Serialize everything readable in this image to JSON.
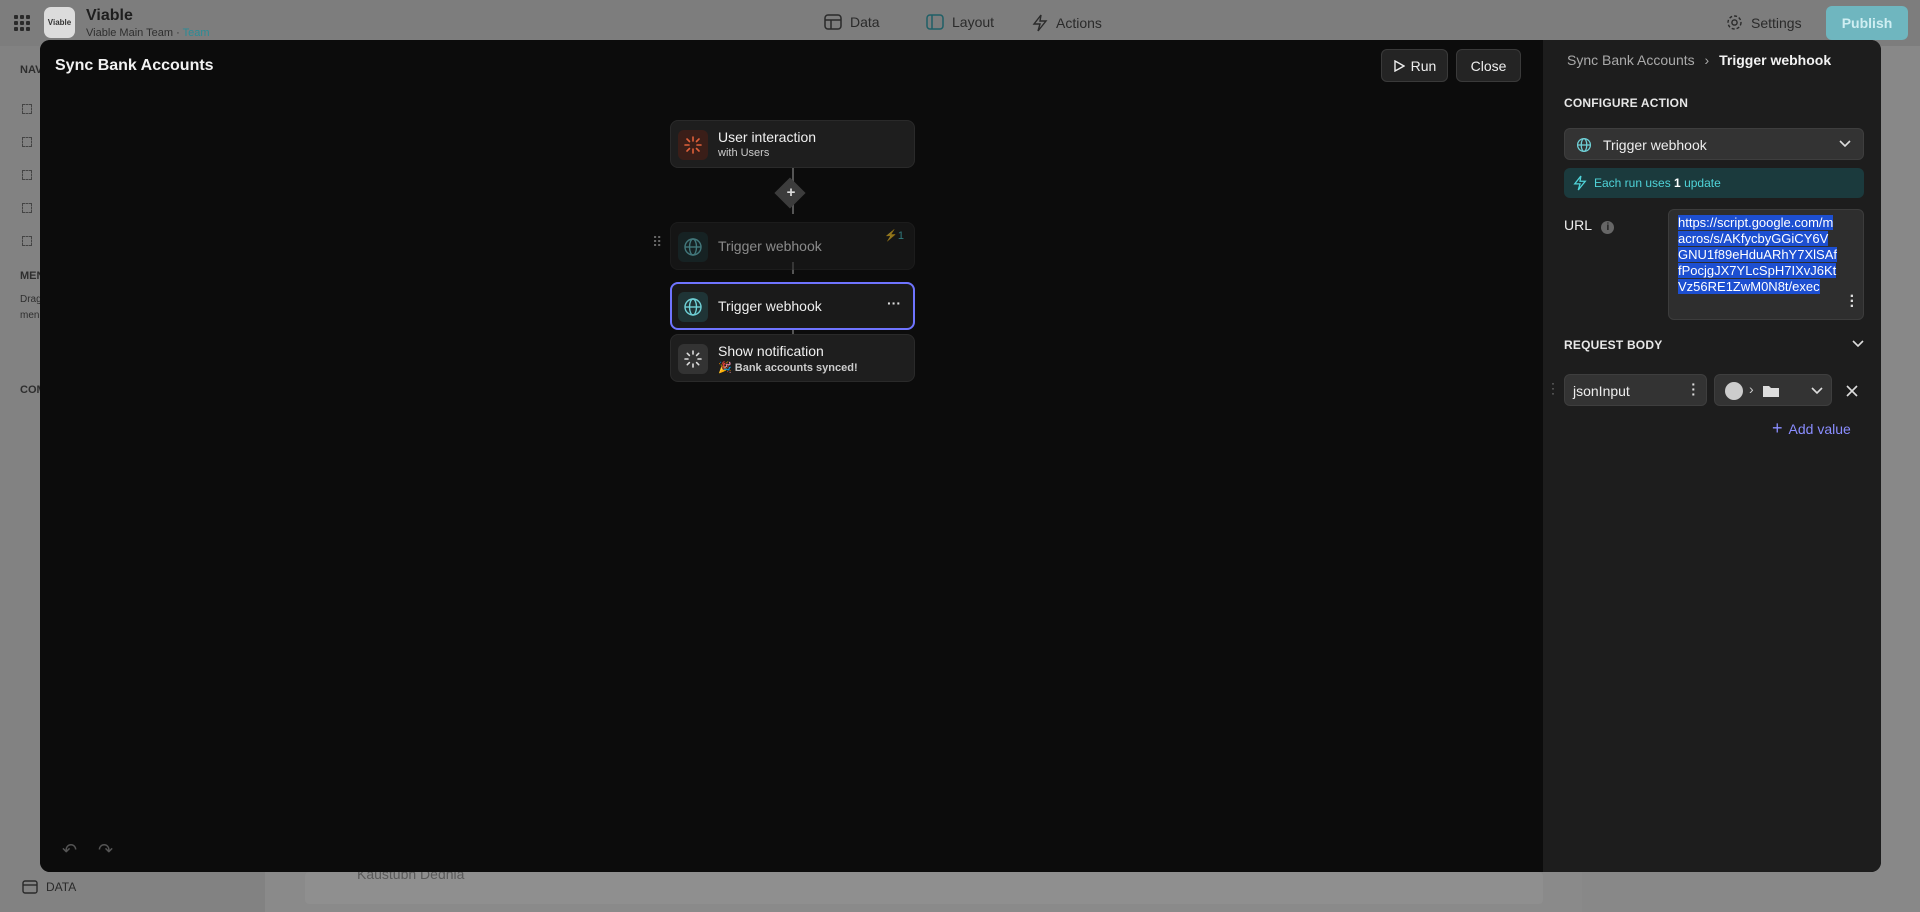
{
  "app": {
    "logo": "Viable",
    "title": "Viable",
    "team": "Viable Main Team",
    "team_link": "Team"
  },
  "topnav": {
    "data": "Data",
    "layout": "Layout",
    "actions": "Actions",
    "settings": "Settings",
    "publish": "Publish"
  },
  "left": {
    "nav": "NAV",
    "menu": "MEN",
    "menu_desc1": "Drag",
    "menu_desc2": "men",
    "comp": "COM",
    "data_tab": "DATA"
  },
  "bottom": {
    "name": "Kaustubh Dedhia"
  },
  "modal": {
    "title": "Sync Bank Accounts",
    "run": "Run",
    "close": "Close"
  },
  "flow": {
    "n1": {
      "title": "User interaction",
      "sub": "with Users"
    },
    "n2": {
      "title": "Trigger webhook",
      "badge": "1"
    },
    "n3": {
      "title": "Trigger webhook",
      "more": "···"
    },
    "n4": {
      "title": "Show notification",
      "sub": "🎉 Bank accounts synced!"
    }
  },
  "panel": {
    "crumb_parent": "Sync Bank Accounts",
    "crumb_sep": "›",
    "crumb_current": "Trigger webhook",
    "configure": "CONFIGURE ACTION",
    "action": "Trigger webhook",
    "info_pre": "Each run uses ",
    "info_count": "1",
    "info_post": " update",
    "url_label": "URL",
    "url": "https://script.google.com/macros/s/AKfycbyGGiCY6VGNU1f89eHduARhY7XlSAffPocjgJX7YLcSpH7IXvJ6KtVz56RE1ZwM0N8t/exec",
    "request_body": "REQUEST BODY",
    "key": "jsonInput",
    "add_value": "Add value"
  },
  "colors": {
    "accent": "#8a8dff",
    "teal": "#4fd3d8",
    "selected_border": "#6f74ff"
  }
}
